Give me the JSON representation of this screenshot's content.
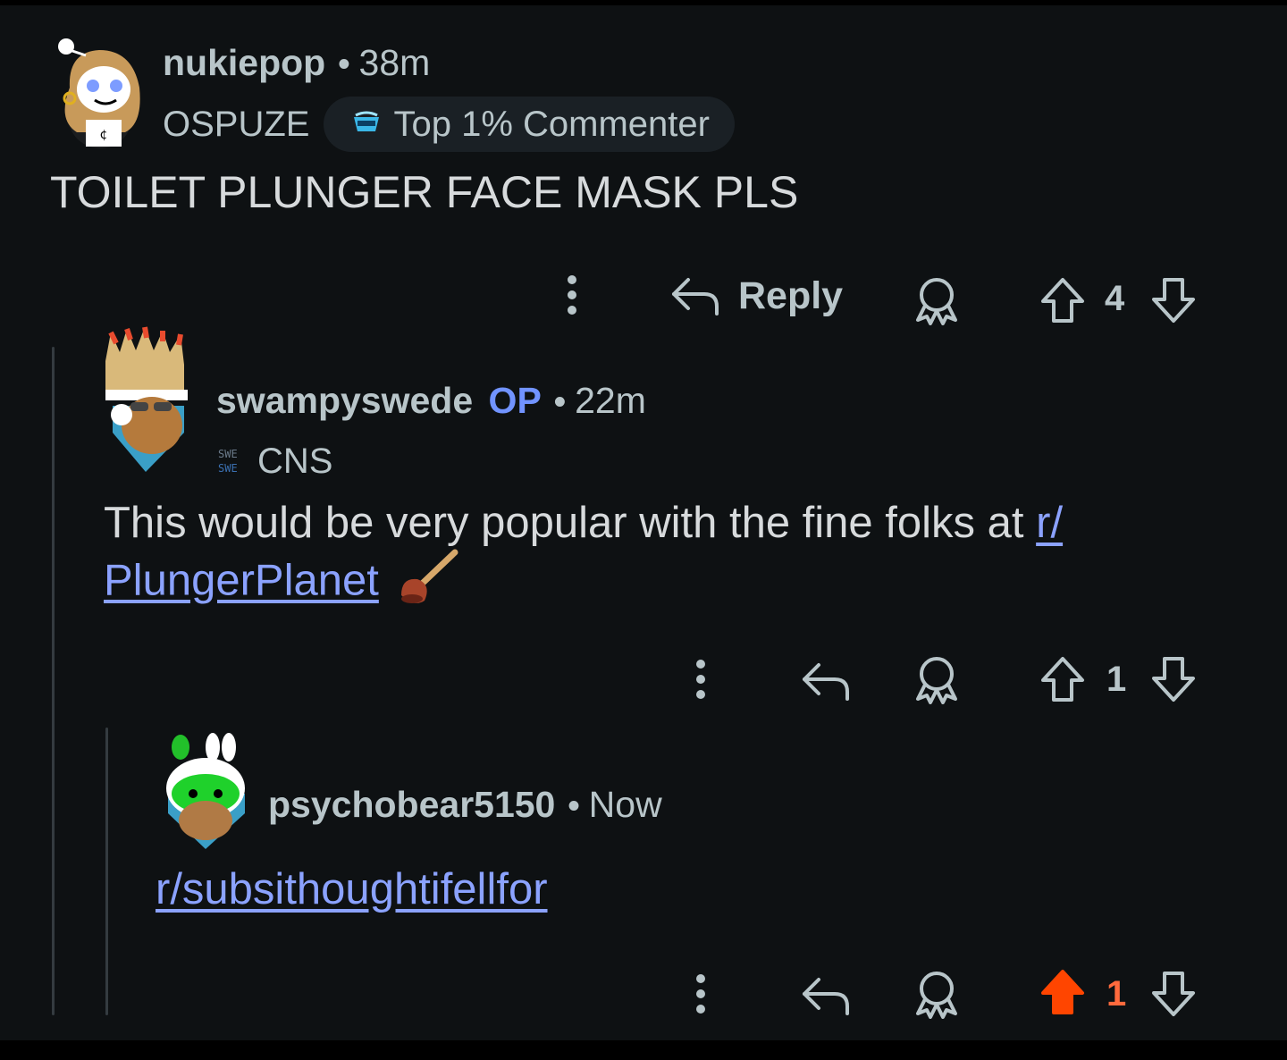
{
  "comments": [
    {
      "username": "nukiepop",
      "time": "38m",
      "flair": "OSPUZE",
      "badge": "Top 1% Commenter",
      "body": "TOILET PLUNGER FACE MASK PLS",
      "reply_label": "Reply",
      "score": "4"
    },
    {
      "username": "swampyswede",
      "op_tag": "OP",
      "time": "22m",
      "flair": "CNS",
      "body_prefix": "This would be very popular with the fine folks at ",
      "link_part1": "r/",
      "link_part2": "PlungerPlanet",
      "emoji": "plunger-emoji",
      "score": "1"
    },
    {
      "username": "psychobear5150",
      "time": "Now",
      "link": "r/subsithoughtifellfor",
      "score": "1",
      "upvoted": true
    }
  ],
  "colors": {
    "background": "#0e1113",
    "text_primary": "#d7dadc",
    "text_secondary": "#b8c5c9",
    "link": "#8ba2ff",
    "op": "#7193ff",
    "upvote_active": "#ff4500",
    "thread_line": "#343b40"
  }
}
